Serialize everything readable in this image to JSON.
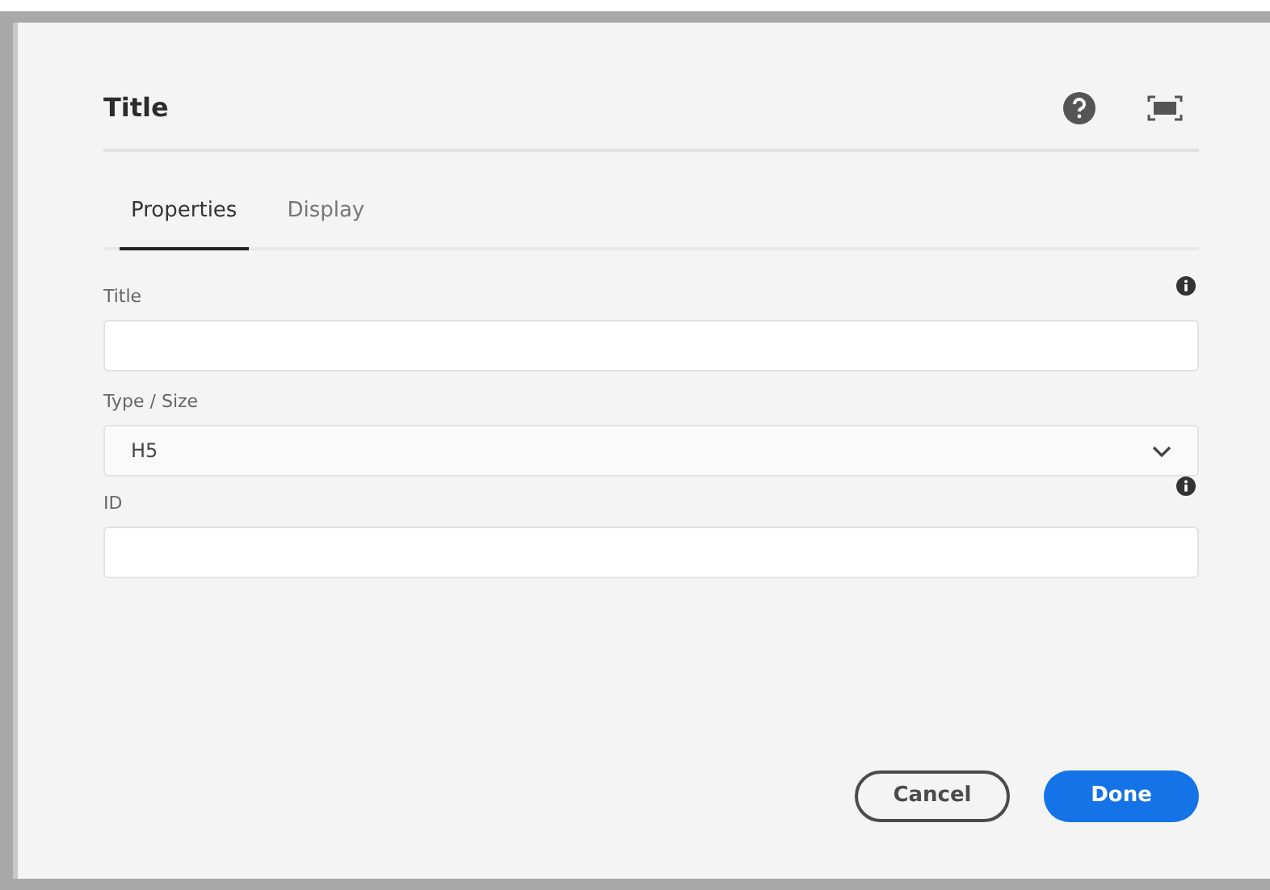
{
  "dialog": {
    "title": "Title"
  },
  "tabs": [
    {
      "label": "Properties",
      "selected": true
    },
    {
      "label": "Display",
      "selected": false
    }
  ],
  "fields": [
    {
      "kind": "text",
      "label": "Title",
      "info": true
    },
    {
      "kind": "select",
      "label": "Type / Size",
      "value": "H5",
      "info": false
    },
    {
      "kind": "text",
      "label": "ID",
      "info": true
    }
  ],
  "buttons": [
    {
      "kind": "secondary",
      "label": "Cancel"
    },
    {
      "kind": "primary",
      "label": "Done"
    }
  ]
}
